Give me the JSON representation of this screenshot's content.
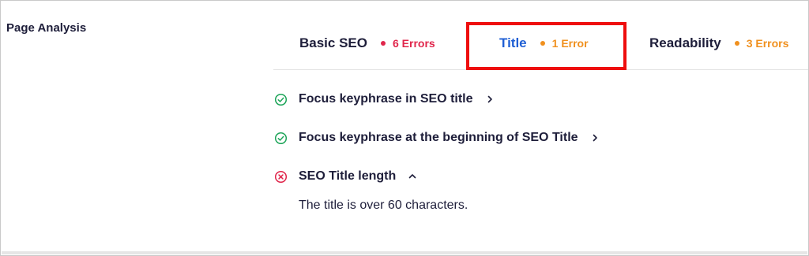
{
  "section_label": "Page Analysis",
  "tabs": [
    {
      "label": "Basic SEO",
      "count_text": "6 Errors",
      "status_color": "#e0264b",
      "active": false
    },
    {
      "label": "Title",
      "count_text": "1 Error",
      "status_color": "#f0901e",
      "active": true
    },
    {
      "label": "Readability",
      "count_text": "3 Errors",
      "status_color": "#f0901e",
      "active": false
    }
  ],
  "results": [
    {
      "label": "Focus keyphrase in SEO title",
      "status": "pass",
      "icon": "check-circle-icon",
      "chevron": "chevron-right-icon"
    },
    {
      "label": "Focus keyphrase at the beginning of SEO Title",
      "status": "pass",
      "icon": "check-circle-icon",
      "chevron": "chevron-right-icon"
    },
    {
      "label": "SEO Title length",
      "status": "fail",
      "icon": "x-circle-icon",
      "chevron": "chevron-up-icon",
      "expanded": true,
      "detail": "The title is over 60 characters."
    }
  ],
  "colors": {
    "pass": "#1fa55a",
    "fail": "#e0264b",
    "active_tab": "#1f5fd4",
    "highlight_box": "#ee0d0d"
  }
}
